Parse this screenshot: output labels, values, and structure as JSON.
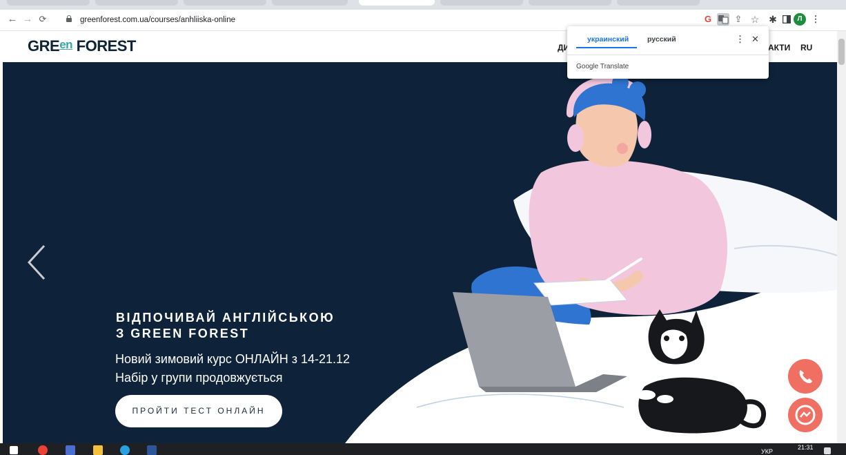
{
  "browser": {
    "url": "greenforest.com.ua/courses/anhliiska-online",
    "profile_initial": "Л",
    "icons": [
      "back-icon",
      "forward-icon",
      "reload-icon",
      "lock-icon",
      "google-icon",
      "translate-icon",
      "share-icon",
      "bookmark-star-icon",
      "extensions-icon",
      "sidepanel-icon",
      "profile-avatar",
      "menu-icon"
    ]
  },
  "translate_popup": {
    "languages": [
      "украинский",
      "русский"
    ],
    "selected": "украинский",
    "brand": "Google Translate"
  },
  "site": {
    "logo": {
      "part1": "GRE",
      "part2": "en",
      "part3": " FOREST"
    },
    "nav": {
      "left_clipped": "ДИ",
      "right_clipped": "АКТИ",
      "lang": "RU"
    }
  },
  "hero": {
    "title_line1": "ВІДПОЧИВАЙ АНГЛІЙСЬКОЮ",
    "title_line2": "З GREEN FOREST",
    "subtitle_line1": "Новий зимовий курс ОНЛАЙН з 14-21.12",
    "subtitle_line2": "Набір у групи продовжується",
    "cta": "ПРОЙТИ ТЕСТ ОНЛАЙН"
  },
  "taskbar": {
    "lang": "УКР",
    "time": "21:31"
  },
  "colors": {
    "hero_bg": "#0e2239",
    "accent_teal": "#38a6a9",
    "fab": "#ef6f63",
    "translate_blue": "#1a73e8"
  }
}
